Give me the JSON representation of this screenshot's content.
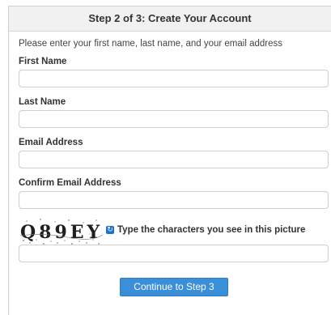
{
  "header": {
    "title": "Step 2 of 3: Create Your Account"
  },
  "instructions": "Please enter your first name, last name, and your email address",
  "fields": [
    {
      "label": "First Name",
      "value": ""
    },
    {
      "label": "Last Name",
      "value": ""
    },
    {
      "label": "Email Address",
      "value": ""
    },
    {
      "label": "Confirm Email Address",
      "value": ""
    }
  ],
  "captcha": {
    "image_text": "Q89EY",
    "icon": "refresh-icon",
    "prompt": "Type the characters you see in this picture",
    "value": ""
  },
  "continue_label": "Continue to Step 3",
  "colors": {
    "button": "#3a8fd8",
    "header_bg": "#f1f1f1",
    "border": "#cfcfcf"
  }
}
